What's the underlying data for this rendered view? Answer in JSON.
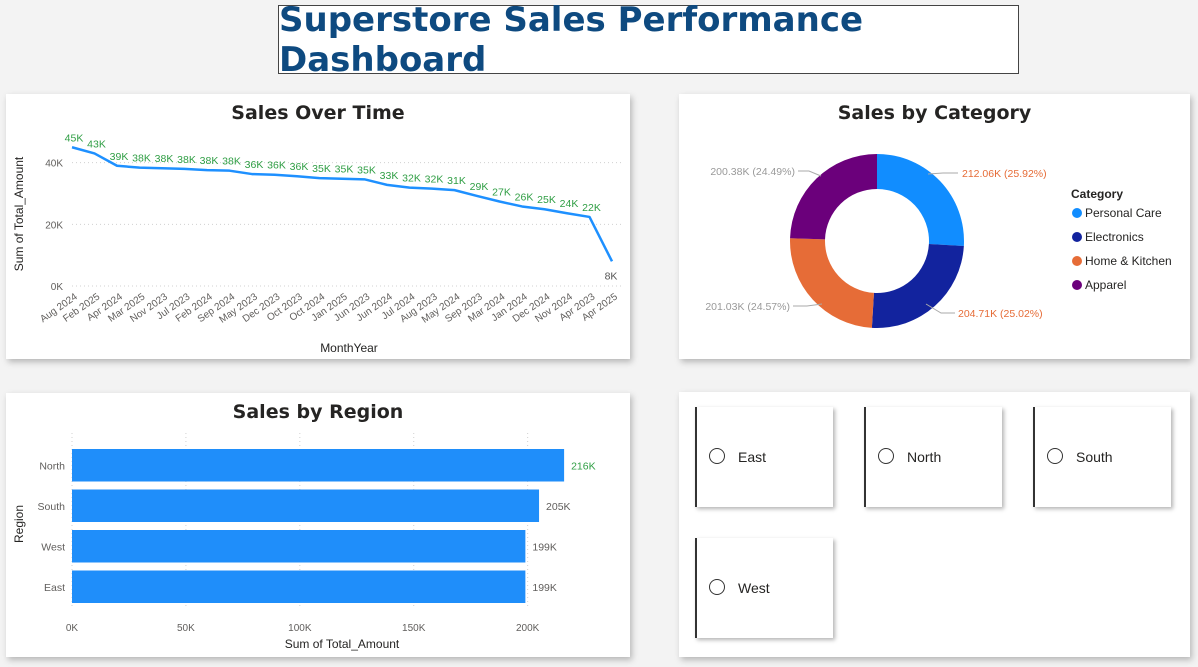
{
  "header": {
    "title": "Superstore Sales Performance Dashboard"
  },
  "colors": {
    "line": "#1e90ff",
    "bar": "#1f8efa",
    "label_green": "#2f9e44",
    "title": "#0e4a80"
  },
  "sales_over_time": {
    "title": "Sales Over Time",
    "xlabel": "MonthYear",
    "ylabel": "Sum of Total_Amount",
    "yticks": [
      "0K",
      "20K",
      "40K"
    ]
  },
  "sales_by_category": {
    "title": "Sales by Category",
    "legend_title": "Category",
    "legend": [
      "Personal Care",
      "Electronics",
      "Home & Kitchen",
      "Apparel"
    ],
    "slice_labels": [
      "212.06K (25.92%)",
      "204.71K (25.02%)",
      "201.03K (24.57%)",
      "200.38K (24.49%)"
    ]
  },
  "sales_by_region": {
    "title": "Sales by Region",
    "xlabel": "Sum of Total_Amount",
    "ylabel": "Region",
    "xticks": [
      "0K",
      "50K",
      "100K",
      "150K",
      "200K"
    ]
  },
  "slicer": {
    "options": [
      "East",
      "North",
      "South",
      "West"
    ]
  },
  "chart_data": [
    {
      "type": "line",
      "title": "Sales Over Time",
      "xlabel": "MonthYear",
      "ylabel": "Sum of Total_Amount",
      "categories": [
        "Aug 2024",
        "Feb 2025",
        "Apr 2024",
        "Mar 2025",
        "Nov 2023",
        "Jul 2023",
        "Feb 2024",
        "Sep 2024",
        "May 2023",
        "Dec 2023",
        "Oct 2023",
        "Oct 2024",
        "Jan 2025",
        "Jun 2023",
        "Jun 2024",
        "Jul 2024",
        "Aug 2023",
        "May 2024",
        "Sep 2023",
        "Mar 2024",
        "Jan 2024",
        "Dec 2024",
        "Nov 2024",
        "Apr 2023",
        "Apr 2025"
      ],
      "values": [
        45,
        43,
        39,
        38.4,
        38.2,
        38,
        37.6,
        37.4,
        36.3,
        36.1,
        35.6,
        35,
        34.8,
        34.6,
        32.8,
        31.9,
        31.6,
        31.1,
        29.2,
        27.4,
        25.8,
        24.9,
        23.6,
        22.4,
        8
      ],
      "data_labels": [
        "45K",
        "43K",
        "39K",
        "38K",
        "38K",
        "38K",
        "38K",
        "38K",
        "36K",
        "36K",
        "36K",
        "35K",
        "35K",
        "35K",
        "33K",
        "32K",
        "32K",
        "31K",
        "29K",
        "27K",
        "26K",
        "25K",
        "24K",
        "22K",
        "8K"
      ],
      "ylim": [
        0,
        48
      ],
      "grid": true
    },
    {
      "type": "pie",
      "title": "Sales by Category",
      "categories": [
        "Personal Care",
        "Electronics",
        "Home & Kitchen",
        "Apparel"
      ],
      "values": [
        212.06,
        204.71,
        201.03,
        200.38
      ],
      "colors": [
        "#118dff",
        "#12239e",
        "#e66c37",
        "#6b007b"
      ],
      "legend_position": "right"
    },
    {
      "type": "bar",
      "title": "Sales by Region",
      "xlabel": "Sum of Total_Amount",
      "ylabel": "Region",
      "categories": [
        "North",
        "South",
        "West",
        "East"
      ],
      "values": [
        216,
        205,
        199,
        199
      ],
      "data_labels": [
        "216K",
        "205K",
        "199K",
        "199K"
      ],
      "xlim": [
        0,
        230
      ]
    }
  ]
}
